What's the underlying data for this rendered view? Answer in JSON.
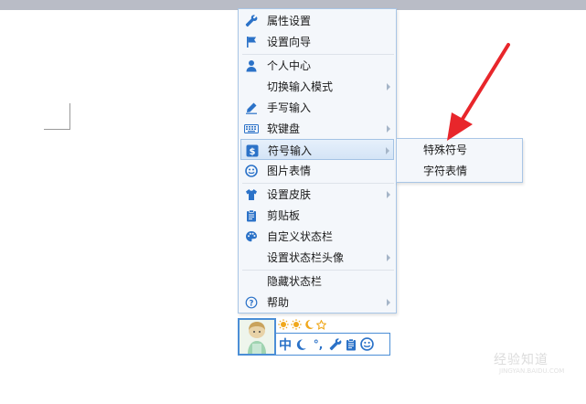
{
  "menu": {
    "items": [
      {
        "label": "属性设置",
        "icon": "wrench-icon"
      },
      {
        "label": "设置向导",
        "icon": "flag-icon"
      },
      {
        "label": "个人中心",
        "icon": "user-icon"
      },
      {
        "label": "切换输入模式",
        "icon": "",
        "submenu": true
      },
      {
        "label": "手写输入",
        "icon": "pen-icon"
      },
      {
        "label": "软键盘",
        "icon": "keyboard-icon",
        "submenu": true
      },
      {
        "label": "符号输入",
        "icon": "dollar-icon",
        "submenu": true,
        "active": true
      },
      {
        "label": "图片表情",
        "icon": "smiley-icon"
      },
      {
        "label": "设置皮肤",
        "icon": "tshirt-icon",
        "submenu": true
      },
      {
        "label": "剪贴板",
        "icon": "clipboard-icon"
      },
      {
        "label": "自定义状态栏",
        "icon": "palette-icon"
      },
      {
        "label": "设置状态栏头像",
        "icon": "",
        "submenu": true
      },
      {
        "label": "隐藏状态栏",
        "icon": ""
      },
      {
        "label": "帮助",
        "icon": "help-icon",
        "submenu": true
      }
    ]
  },
  "submenu": {
    "items": [
      {
        "label": "特殊符号"
      },
      {
        "label": "字符表情"
      }
    ]
  },
  "statusbar": {
    "mode_label": "中",
    "punct_label": "°,",
    "icons": [
      "half-moon-icon",
      "wrench-icon",
      "clipboard-icon",
      "smiley-icon"
    ],
    "level_icons": [
      "sun-icon",
      "sun-icon",
      "moon-icon",
      "star-icon"
    ]
  },
  "watermark": {
    "text": "经验知道",
    "sub": "JINGYAN.BAIDU.COM"
  },
  "colors": {
    "icon_blue": "#2b72c8",
    "menu_border": "#a9c6e6",
    "arrow_red": "#e8262b",
    "level_orange": "#f0a81c"
  }
}
